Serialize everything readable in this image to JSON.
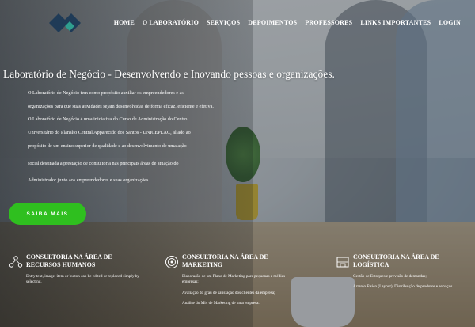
{
  "nav": {
    "items": [
      {
        "label": "HOME"
      },
      {
        "label": "O LABORATÓRIO"
      },
      {
        "label": "SERVIÇOS"
      },
      {
        "label": "DEPOIMENTOS"
      },
      {
        "label": "PROFESSORES"
      },
      {
        "label": "LINKS IMPORTANTES"
      },
      {
        "label": "LOGIN"
      }
    ]
  },
  "logo": {
    "icon": "diamond-logo-icon",
    "colors": [
      "#1f3b57",
      "#2f9e8f"
    ]
  },
  "hero": {
    "title": "Laboratório de Negócio - Desenvolvendo e Inovando pessoas e organizações.",
    "paragraphs": [
      "O Laboratório de Negócio tem como propósito auxiliar os empreendedores e as",
      "organizações para que suas atividades sejam desenvolvidas de forma eficaz, eficiente e efetiva.",
      "O Laboratório de Negócio é uma iniciativa do Curso de Administração do Centro",
      "Universitário do Planalto Central Apparecido dos Santos - UNICEPLAC, aliado ao",
      "propósito de um ensino superior de qualidade e ao desenvolvimento de uma ação",
      "social destinada a prestação de consultoria nas principais áreas de atuação do",
      "Administrador junto aos empreendedores e suas organizações."
    ],
    "cta_label": "SAIBA MAIS",
    "cta_color": "#2fbf1f"
  },
  "cards": [
    {
      "title": "CONSULTORIA NA ÁREA DE RECURSOS HUMANOS",
      "icon": "people-network-icon",
      "lines": [
        "Entry text, image, item or button can be edited or replaced simply by selecting."
      ]
    },
    {
      "title": "CONSULTORIA NA ÁREA DE MARKETING",
      "icon": "target-icon",
      "lines": [
        "Elaboração de um Plano de Marketing para pequenas e médias empresas;",
        "Avaliação do grau de satisfação dos clientes da empresa;",
        "Análise do Mix de Marketing de uma empresa."
      ]
    },
    {
      "title": "CONSULTORIA NA ÁREA DE LOGÍSTICA",
      "icon": "warehouse-icon",
      "lines": [
        "Gestão de Estoques e previsão de demandas;",
        "Arranjo Físico (Layout), Distribuição de produtos e serviços."
      ]
    }
  ]
}
